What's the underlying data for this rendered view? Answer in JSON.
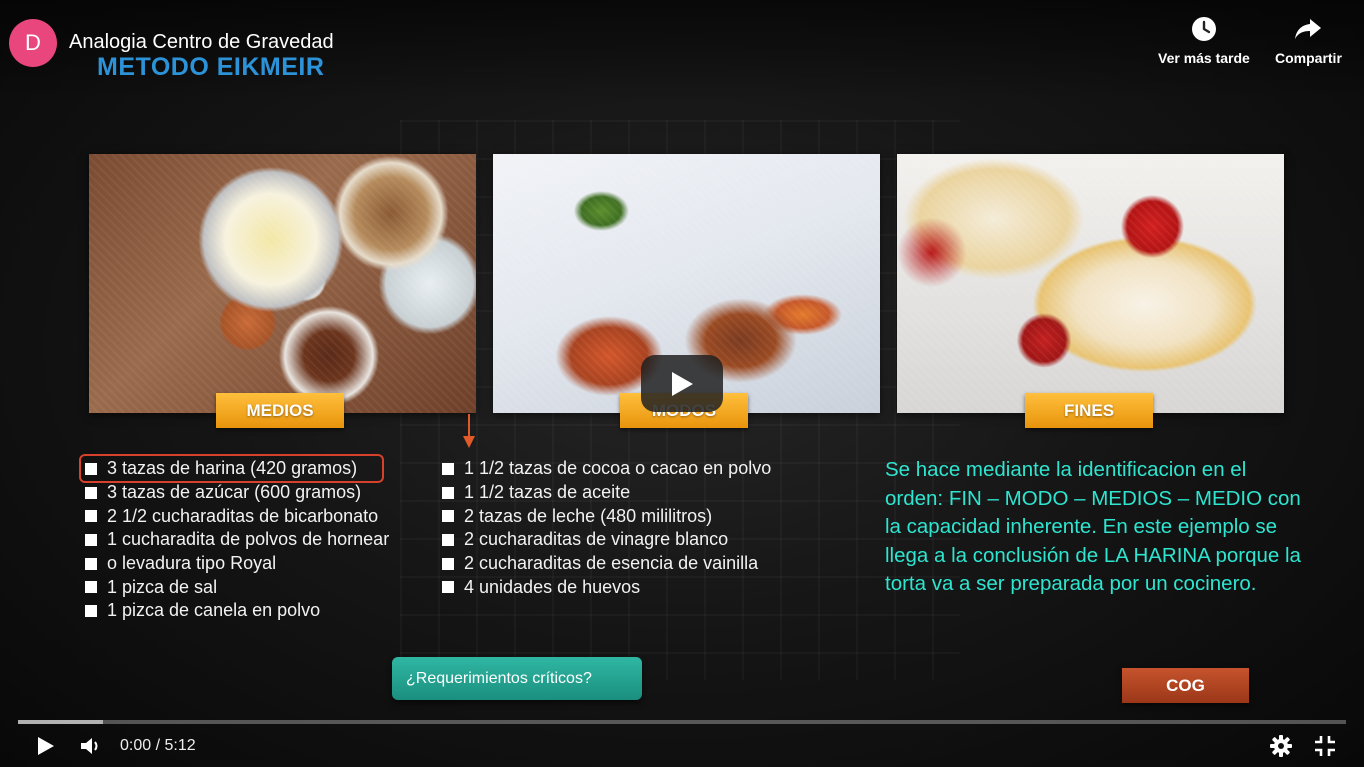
{
  "channel": {
    "avatar_letter": "D"
  },
  "video": {
    "title": "Analogia Centro de Gravedad",
    "subtitle": "METODO EIKMEIR"
  },
  "top_actions": {
    "watch_later": "Ver más tarde",
    "share": "Compartir"
  },
  "slide": {
    "labels": {
      "medios": "MEDIOS",
      "modos": "MODOS",
      "fines": "FINES"
    },
    "ingredients_left": [
      "3 tazas de harina (420 gramos)",
      "3 tazas de azúcar (600 gramos)",
      "2 1/2 cucharaditas de bicarbonato",
      "1 cucharadita de polvos de hornear",
      "o levadura tipo Royal",
      "1 pizca de sal",
      "1 pizca de canela en polvo"
    ],
    "ingredients_right": [
      "1 1/2 tazas de cocoa o cacao en polvo",
      "1 1/2 tazas de aceite",
      "2 tazas de leche (480 mililitros)",
      "2 cucharaditas de vinagre blanco",
      "2 cucharaditas de esencia de vainilla",
      "4 unidades de huevos"
    ],
    "explanation": "Se hace mediante la identificacion en el orden: FIN – MODO – MEDIOS – MEDIO con la capacidad inherente. En este ejemplo se llega a la conclusión de LA HARINA porque la torta va a ser preparada por un cocinero.",
    "btn_requirements": "¿Requerimientos críticos?",
    "btn_cog": "COG"
  },
  "player": {
    "time_display": "0:00 / 5:12",
    "buffered_fraction": 0.064,
    "played_fraction": 0
  },
  "colors": {
    "accent_cyan": "#2ee5d0",
    "tag_orange": "#f2a623",
    "req_teal": "#22a08f",
    "cog_red": "#b0441f",
    "title_blue": "#2c93d8"
  }
}
